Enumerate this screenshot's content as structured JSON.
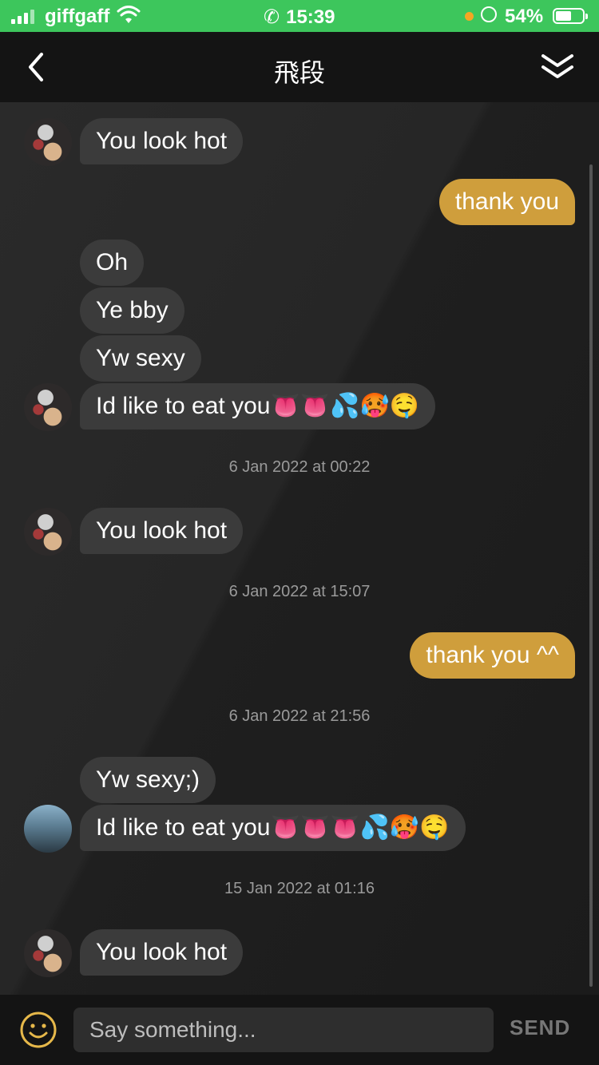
{
  "status_bar": {
    "carrier": "giffgaff",
    "time": "15:39",
    "battery": "54%",
    "battery_level": 0.54,
    "colors": {
      "background": "#3dc65c",
      "dot": "#f5a623"
    }
  },
  "header": {
    "title": "飛段",
    "back_icon": "chevron-left-icon",
    "collapse_icon": "double-chevron-down-icon"
  },
  "messages": [
    {
      "sender": "them",
      "text": "You look hot",
      "avatar": "anime-avatar"
    },
    {
      "sender": "me",
      "text": "thank you"
    },
    {
      "sender": "them",
      "text": "Oh"
    },
    {
      "sender": "them",
      "text": "Ye bby"
    },
    {
      "sender": "them",
      "text": "Yw sexy"
    },
    {
      "sender": "them",
      "text": "Id like to eat you👅👅💦🥵🤤",
      "avatar": "anime-avatar"
    },
    {
      "type": "timestamp",
      "text": "6 Jan 2022 at 00:22"
    },
    {
      "sender": "them",
      "text": "You look hot",
      "avatar": "anime-avatar"
    },
    {
      "type": "timestamp",
      "text": "6 Jan 2022 at 15:07"
    },
    {
      "sender": "me",
      "text": "thank you ^^"
    },
    {
      "type": "timestamp",
      "text": "6 Jan 2022 at 21:56"
    },
    {
      "sender": "them",
      "text": "Yw sexy;)"
    },
    {
      "sender": "them",
      "text": "Id like to eat you👅👅👅💦🥵🤤",
      "avatar": "photo-avatar"
    },
    {
      "type": "timestamp",
      "text": "15 Jan 2022 at 01:16"
    },
    {
      "sender": "them",
      "text": "You look hot",
      "avatar": "anime-avatar"
    }
  ],
  "composer": {
    "placeholder": "Say something...",
    "send_label": "SEND",
    "emoji_icon": "smiley-icon"
  },
  "colors": {
    "outgoing_bubble": "#cf9e3c",
    "incoming_bubble": "#3b3b3b",
    "background": "#1e1e1e",
    "emoji_button": "#e6b84a"
  }
}
